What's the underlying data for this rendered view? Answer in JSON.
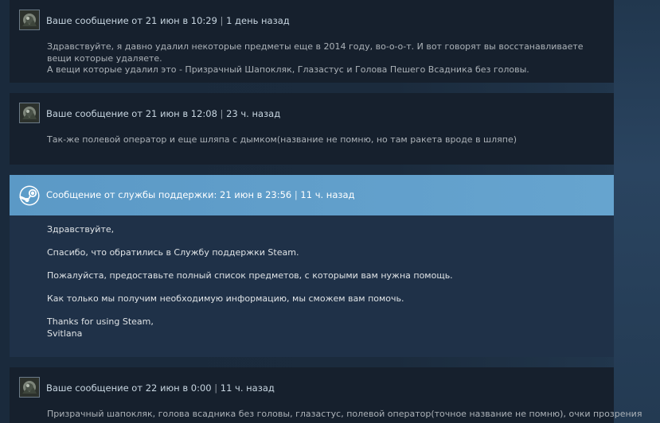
{
  "messages": [
    {
      "type": "user",
      "author_label": "Ваше сообщение от 21 июн в 10:29",
      "relative_time": "1 день назад",
      "lines": [
        "Здравствуйте, я давно удалил некоторые предметы еще в 2014 году, во-о-о-т. И вот говорят вы восстанавливаете вещи которые удаляете.",
        "А вещи которые удалил это - Призрачный Шапокляк, Глазастус и Голова Пешего Всадника без головы."
      ]
    },
    {
      "type": "user",
      "author_label": "Ваше сообщение от 21 июн в 12:08",
      "relative_time": "23 ч. назад",
      "lines": [
        "Так-же полевой оператор и еще шляпа с дымком(название не помню, но там ракета вроде в шляпе)"
      ]
    },
    {
      "type": "support",
      "author_label": "Сообщение от службы поддержки: 21 июн в 23:56",
      "relative_time": "11 ч. назад",
      "paragraphs": [
        "Здравствуйте,",
        "Спасибо, что обратились в Службу поддержки Steam.",
        "Пожалуйста, предоставьте полный список предметов, с которыми вам нужна помощь.",
        "Как только мы получим необходимую информацию, мы сможем вам помочь."
      ],
      "signoff": "Thanks for using Steam,",
      "signature": "Svitlana"
    },
    {
      "type": "user",
      "author_label": "Ваше сообщение от 22 июн в 0:00",
      "relative_time": "11 ч. назад",
      "lines": [
        "Призрачный шапокляк, голова всадника без головы, глазастус, полевой оператор(точное название не помню), очки прозрения"
      ]
    }
  ],
  "separator": "|",
  "colors": {
    "page_background": "#1b2838",
    "user_message_background": "#16202d",
    "support_header_background": "#5d9dc9",
    "support_body_background": "#1f3148",
    "header_text": "#c7d5e0",
    "body_text": "#acb2b8"
  },
  "icons": {
    "user_avatar": "avatar-image",
    "support_avatar": "steam-logo-icon"
  }
}
